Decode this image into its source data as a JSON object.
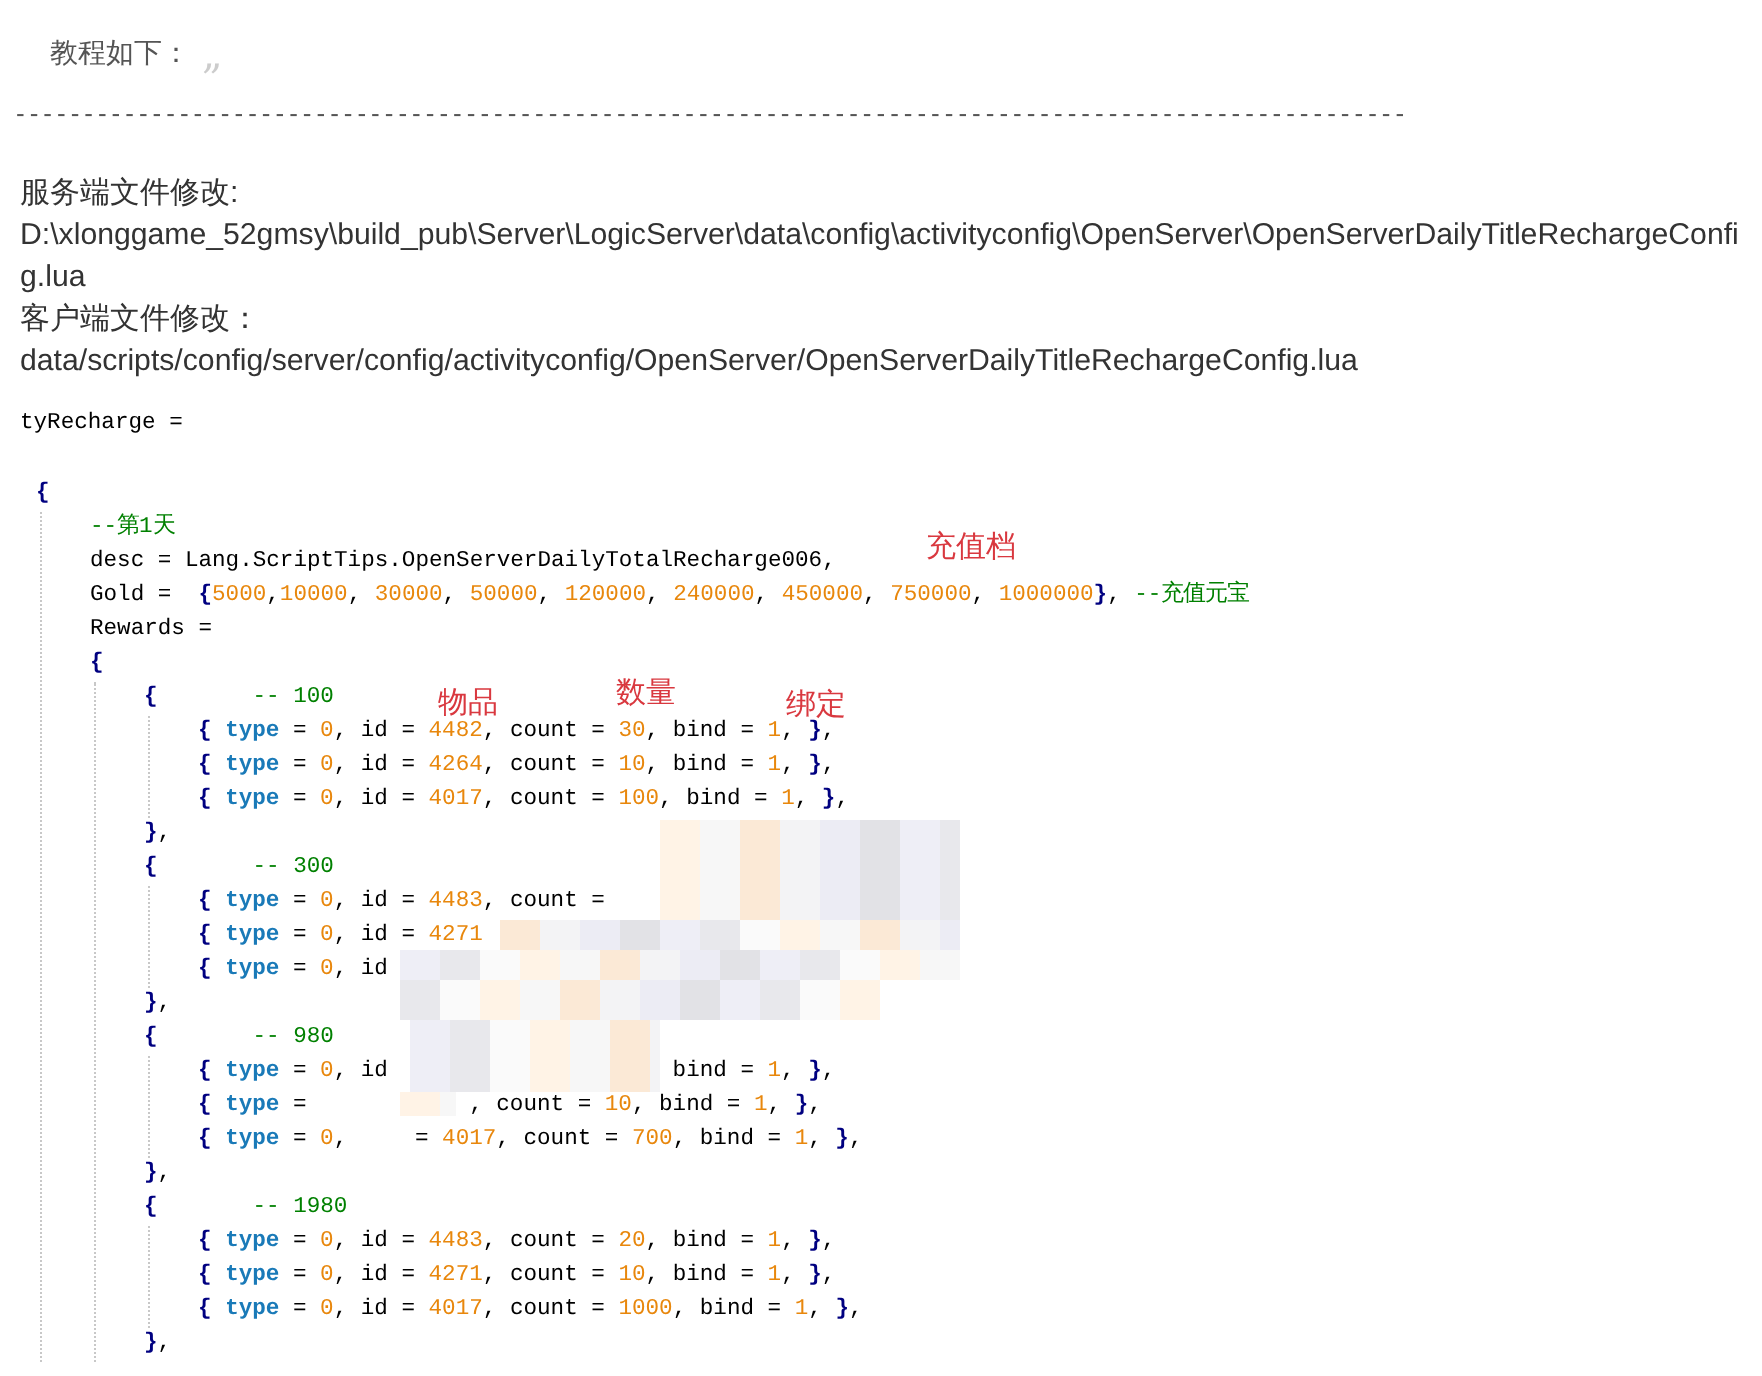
{
  "intro": {
    "text": "教程如下：",
    "quote_mark": "„"
  },
  "separator": "------------------------------------------------------------------------------------------------------",
  "sections": [
    {
      "heading": "服务端文件修改:",
      "path": "D:\\xlonggame_52gmsy\\build_pub\\Server\\LogicServer\\data\\config\\activityconfig\\OpenServer\\OpenServerDailyTitleRechargeConfig.lua"
    },
    {
      "heading": "客户端文件修改：",
      "path": "data/scripts/config/server/config/activityconfig/OpenServer/OpenServerDailyTitleRechargeConfig.lua"
    }
  ],
  "code_image": {
    "header_line": "tyRecharge =",
    "annotations": [
      {
        "text": "充值档"
      },
      {
        "text": "物品"
      },
      {
        "text": "数量"
      },
      {
        "text": "绑定"
      }
    ],
    "lines": [
      {
        "tokens": [
          {
            "kind": "brace",
            "text": "{"
          }
        ]
      },
      {
        "children": [
          {
            "tokens": [
              {
                "kind": "comment",
                "text": "--第1天"
              }
            ]
          },
          {
            "tokens": [
              {
                "kind": "plain",
                "text": "desc = Lang.ScriptTips.OpenServerDailyTotalRecharge006,"
              }
            ]
          },
          {
            "tokens": [
              {
                "kind": "plain",
                "text": "Gold =  "
              },
              {
                "kind": "brace",
                "text": "{"
              },
              {
                "kind": "num",
                "text": "5000"
              },
              {
                "kind": "plain",
                "text": ","
              },
              {
                "kind": "num",
                "text": "10000"
              },
              {
                "kind": "plain",
                "text": ", "
              },
              {
                "kind": "num",
                "text": "30000"
              },
              {
                "kind": "plain",
                "text": ", "
              },
              {
                "kind": "num",
                "text": "50000"
              },
              {
                "kind": "plain",
                "text": ", "
              },
              {
                "kind": "num",
                "text": "120000"
              },
              {
                "kind": "plain",
                "text": ", "
              },
              {
                "kind": "num",
                "text": "240000"
              },
              {
                "kind": "plain",
                "text": ", "
              },
              {
                "kind": "num",
                "text": "450000"
              },
              {
                "kind": "plain",
                "text": ", "
              },
              {
                "kind": "num",
                "text": "750000"
              },
              {
                "kind": "plain",
                "text": ", "
              },
              {
                "kind": "num",
                "text": "1000000"
              },
              {
                "kind": "brace",
                "text": "}"
              },
              {
                "kind": "plain",
                "text": ", "
              },
              {
                "kind": "comment",
                "text": "--充值元宝"
              }
            ]
          },
          {
            "tokens": [
              {
                "kind": "plain",
                "text": "Rewards ="
              }
            ]
          },
          {
            "tokens": [
              {
                "kind": "brace",
                "text": "{"
              }
            ]
          },
          {
            "children": [
              {
                "tokens": [
                  {
                    "kind": "brace",
                    "text": "{"
                  },
                  {
                    "kind": "comment",
                    "text": "       -- 100"
                  }
                ]
              },
              {
                "children": [
                  {
                    "tokens": [
                      {
                        "kind": "brace",
                        "text": "{ "
                      },
                      {
                        "kind": "kw",
                        "text": "type"
                      },
                      {
                        "kind": "plain",
                        "text": " = "
                      },
                      {
                        "kind": "num",
                        "text": "0"
                      },
                      {
                        "kind": "plain",
                        "text": ", id = "
                      },
                      {
                        "kind": "num",
                        "text": "4482"
                      },
                      {
                        "kind": "plain",
                        "text": ", count = "
                      },
                      {
                        "kind": "num",
                        "text": "30"
                      },
                      {
                        "kind": "plain",
                        "text": ", bind = "
                      },
                      {
                        "kind": "num",
                        "text": "1"
                      },
                      {
                        "kind": "plain",
                        "text": ", "
                      },
                      {
                        "kind": "brace",
                        "text": "}"
                      },
                      {
                        "kind": "plain",
                        "text": ","
                      }
                    ]
                  },
                  {
                    "tokens": [
                      {
                        "kind": "brace",
                        "text": "{ "
                      },
                      {
                        "kind": "kw",
                        "text": "type"
                      },
                      {
                        "kind": "plain",
                        "text": " = "
                      },
                      {
                        "kind": "num",
                        "text": "0"
                      },
                      {
                        "kind": "plain",
                        "text": ", id = "
                      },
                      {
                        "kind": "num",
                        "text": "4264"
                      },
                      {
                        "kind": "plain",
                        "text": ", count = "
                      },
                      {
                        "kind": "num",
                        "text": "10"
                      },
                      {
                        "kind": "plain",
                        "text": ", bind = "
                      },
                      {
                        "kind": "num",
                        "text": "1"
                      },
                      {
                        "kind": "plain",
                        "text": ", "
                      },
                      {
                        "kind": "brace",
                        "text": "}"
                      },
                      {
                        "kind": "plain",
                        "text": ","
                      }
                    ]
                  },
                  {
                    "tokens": [
                      {
                        "kind": "brace",
                        "text": "{ "
                      },
                      {
                        "kind": "kw",
                        "text": "type"
                      },
                      {
                        "kind": "plain",
                        "text": " = "
                      },
                      {
                        "kind": "num",
                        "text": "0"
                      },
                      {
                        "kind": "plain",
                        "text": ", id = "
                      },
                      {
                        "kind": "num",
                        "text": "4017"
                      },
                      {
                        "kind": "plain",
                        "text": ", count = "
                      },
                      {
                        "kind": "num",
                        "text": "100"
                      },
                      {
                        "kind": "plain",
                        "text": ", bind = "
                      },
                      {
                        "kind": "num",
                        "text": "1"
                      },
                      {
                        "kind": "plain",
                        "text": ", "
                      },
                      {
                        "kind": "brace",
                        "text": "}"
                      },
                      {
                        "kind": "plain",
                        "text": ","
                      }
                    ]
                  }
                ]
              },
              {
                "tokens": [
                  {
                    "kind": "brace",
                    "text": "}"
                  },
                  {
                    "kind": "plain",
                    "text": ","
                  }
                ]
              },
              {
                "tokens": [
                  {
                    "kind": "brace",
                    "text": "{"
                  },
                  {
                    "kind": "comment",
                    "text": "       -- 300"
                  }
                ]
              },
              {
                "children": [
                  {
                    "tokens": [
                      {
                        "kind": "brace",
                        "text": "{ "
                      },
                      {
                        "kind": "kw",
                        "text": "type"
                      },
                      {
                        "kind": "plain",
                        "text": " = "
                      },
                      {
                        "kind": "num",
                        "text": "0"
                      },
                      {
                        "kind": "plain",
                        "text": ", id = "
                      },
                      {
                        "kind": "num",
                        "text": "4483"
                      },
                      {
                        "kind": "plain",
                        "text": ", count ="
                      }
                    ]
                  },
                  {
                    "tokens": [
                      {
                        "kind": "brace",
                        "text": "{ "
                      },
                      {
                        "kind": "kw",
                        "text": "type"
                      },
                      {
                        "kind": "plain",
                        "text": " = "
                      },
                      {
                        "kind": "num",
                        "text": "0"
                      },
                      {
                        "kind": "plain",
                        "text": ", id = "
                      },
                      {
                        "kind": "num",
                        "text": "4271"
                      }
                    ]
                  },
                  {
                    "tokens": [
                      {
                        "kind": "brace",
                        "text": "{ "
                      },
                      {
                        "kind": "kw",
                        "text": "type"
                      },
                      {
                        "kind": "plain",
                        "text": " = "
                      },
                      {
                        "kind": "num",
                        "text": "0"
                      },
                      {
                        "kind": "plain",
                        "text": ", id"
                      }
                    ]
                  }
                ]
              },
              {
                "tokens": [
                  {
                    "kind": "brace",
                    "text": "}"
                  },
                  {
                    "kind": "plain",
                    "text": ","
                  }
                ]
              },
              {
                "tokens": [
                  {
                    "kind": "brace",
                    "text": "{"
                  },
                  {
                    "kind": "comment",
                    "text": "       -- 980"
                  }
                ]
              },
              {
                "children": [
                  {
                    "tokens": [
                      {
                        "kind": "brace",
                        "text": "{ "
                      },
                      {
                        "kind": "kw",
                        "text": "type"
                      },
                      {
                        "kind": "plain",
                        "text": " = "
                      },
                      {
                        "kind": "num",
                        "text": "0"
                      },
                      {
                        "kind": "plain",
                        "text": ", id                     bind = "
                      },
                      {
                        "kind": "num",
                        "text": "1"
                      },
                      {
                        "kind": "plain",
                        "text": ", "
                      },
                      {
                        "kind": "brace",
                        "text": "}"
                      },
                      {
                        "kind": "plain",
                        "text": ","
                      }
                    ]
                  },
                  {
                    "tokens": [
                      {
                        "kind": "brace",
                        "text": "{ "
                      },
                      {
                        "kind": "kw",
                        "text": "type"
                      },
                      {
                        "kind": "plain",
                        "text": " =            , count = "
                      },
                      {
                        "kind": "num",
                        "text": "10"
                      },
                      {
                        "kind": "plain",
                        "text": ", bind = "
                      },
                      {
                        "kind": "num",
                        "text": "1"
                      },
                      {
                        "kind": "plain",
                        "text": ", "
                      },
                      {
                        "kind": "brace",
                        "text": "}"
                      },
                      {
                        "kind": "plain",
                        "text": ","
                      }
                    ]
                  },
                  {
                    "tokens": [
                      {
                        "kind": "brace",
                        "text": "{ "
                      },
                      {
                        "kind": "kw",
                        "text": "type"
                      },
                      {
                        "kind": "plain",
                        "text": " = "
                      },
                      {
                        "kind": "num",
                        "text": "0"
                      },
                      {
                        "kind": "plain",
                        "text": ",     = "
                      },
                      {
                        "kind": "num",
                        "text": "4017"
                      },
                      {
                        "kind": "plain",
                        "text": ", count = "
                      },
                      {
                        "kind": "num",
                        "text": "700"
                      },
                      {
                        "kind": "plain",
                        "text": ", bind = "
                      },
                      {
                        "kind": "num",
                        "text": "1"
                      },
                      {
                        "kind": "plain",
                        "text": ", "
                      },
                      {
                        "kind": "brace",
                        "text": "}"
                      },
                      {
                        "kind": "plain",
                        "text": ","
                      }
                    ]
                  }
                ]
              },
              {
                "tokens": [
                  {
                    "kind": "brace",
                    "text": "}"
                  },
                  {
                    "kind": "plain",
                    "text": ","
                  }
                ]
              },
              {
                "tokens": [
                  {
                    "kind": "brace",
                    "text": "{"
                  },
                  {
                    "kind": "comment",
                    "text": "       -- 1980"
                  }
                ]
              },
              {
                "children": [
                  {
                    "tokens": [
                      {
                        "kind": "brace",
                        "text": "{ "
                      },
                      {
                        "kind": "kw",
                        "text": "type"
                      },
                      {
                        "kind": "plain",
                        "text": " = "
                      },
                      {
                        "kind": "num",
                        "text": "0"
                      },
                      {
                        "kind": "plain",
                        "text": ", id = "
                      },
                      {
                        "kind": "num",
                        "text": "4483"
                      },
                      {
                        "kind": "plain",
                        "text": ", count = "
                      },
                      {
                        "kind": "num",
                        "text": "20"
                      },
                      {
                        "kind": "plain",
                        "text": ", bind = "
                      },
                      {
                        "kind": "num",
                        "text": "1"
                      },
                      {
                        "kind": "plain",
                        "text": ", "
                      },
                      {
                        "kind": "brace",
                        "text": "}"
                      },
                      {
                        "kind": "plain",
                        "text": ","
                      }
                    ]
                  },
                  {
                    "tokens": [
                      {
                        "kind": "brace",
                        "text": "{ "
                      },
                      {
                        "kind": "kw",
                        "text": "type"
                      },
                      {
                        "kind": "plain",
                        "text": " = "
                      },
                      {
                        "kind": "num",
                        "text": "0"
                      },
                      {
                        "kind": "plain",
                        "text": ", id = "
                      },
                      {
                        "kind": "num",
                        "text": "4271"
                      },
                      {
                        "kind": "plain",
                        "text": ", count = "
                      },
                      {
                        "kind": "num",
                        "text": "10"
                      },
                      {
                        "kind": "plain",
                        "text": ", bind = "
                      },
                      {
                        "kind": "num",
                        "text": "1"
                      },
                      {
                        "kind": "plain",
                        "text": ", "
                      },
                      {
                        "kind": "brace",
                        "text": "}"
                      },
                      {
                        "kind": "plain",
                        "text": ","
                      }
                    ]
                  },
                  {
                    "tokens": [
                      {
                        "kind": "brace",
                        "text": "{ "
                      },
                      {
                        "kind": "kw",
                        "text": "type"
                      },
                      {
                        "kind": "plain",
                        "text": " = "
                      },
                      {
                        "kind": "num",
                        "text": "0"
                      },
                      {
                        "kind": "plain",
                        "text": ", id = "
                      },
                      {
                        "kind": "num",
                        "text": "4017"
                      },
                      {
                        "kind": "plain",
                        "text": ", count = "
                      },
                      {
                        "kind": "num",
                        "text": "1000"
                      },
                      {
                        "kind": "plain",
                        "text": ", bind = "
                      },
                      {
                        "kind": "num",
                        "text": "1"
                      },
                      {
                        "kind": "plain",
                        "text": ", "
                      },
                      {
                        "kind": "brace",
                        "text": "}"
                      },
                      {
                        "kind": "plain",
                        "text": ","
                      }
                    ]
                  }
                ]
              },
              {
                "tokens": [
                  {
                    "kind": "brace",
                    "text": "}"
                  },
                  {
                    "kind": "plain",
                    "text": ","
                  }
                ]
              }
            ]
          }
        ]
      }
    ]
  }
}
